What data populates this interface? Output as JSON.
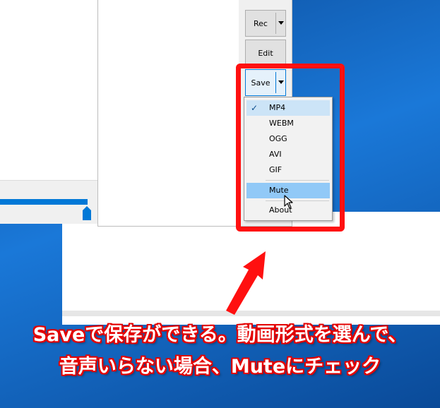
{
  "buttons": {
    "rec_label": "Rec",
    "edit_label": "Edit",
    "save_label": "Save"
  },
  "save_menu": {
    "items": [
      {
        "label": "MP4",
        "checked": true
      },
      {
        "label": "WEBM",
        "checked": false
      },
      {
        "label": "OGG",
        "checked": false
      },
      {
        "label": "AVI",
        "checked": false
      },
      {
        "label": "GIF",
        "checked": false
      },
      {
        "label": "Mute",
        "checked": false,
        "hover": true
      },
      {
        "label": "About",
        "checked": false
      }
    ],
    "check_mark": "✓"
  },
  "annotation": {
    "line1": "Saveで保存ができる。動画形式を選んで、",
    "line2": "音声いらない場合、Muteにチェック",
    "color": "#ff1010"
  },
  "colors": {
    "accent": "#0078d7",
    "hover": "#91c9f7"
  }
}
